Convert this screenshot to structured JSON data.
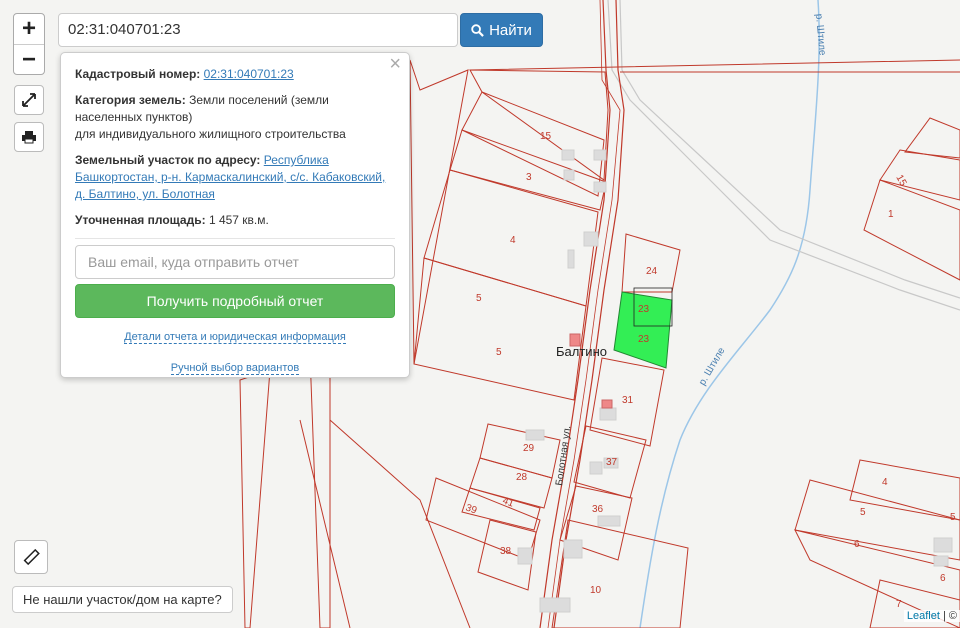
{
  "toolbar": {
    "zoom_in": "+",
    "zoom_out": "−",
    "search_value": "02:31:040701:23",
    "search_button": "Найти"
  },
  "popup": {
    "close": "×",
    "cadastral_label": "Кадастровый номер:",
    "cadastral_value": "02:31:040701:23",
    "category_label": "Категория земель:",
    "category_value": "Земли поселений (земли населенных пунктов)",
    "category_use": "для индивидуального жилищного строительства",
    "address_label": "Земельный участок по адресу:",
    "address_value": "Республика Башкортостан, р-н. Кармаскалинский, с/с. Кабаковский, д. Балтино, ул. Болотная",
    "area_label": "Уточненная площадь:",
    "area_value": "1 457 кв.м.",
    "email_placeholder": "Ваш email, куда отправить отчет",
    "report_button": "Получить подробный отчет",
    "details_link": "Детали отчета и юридическая информация",
    "manual_link": "Ручной выбор вариантов"
  },
  "not_found_button": "Не нашли участок/дом на карте?",
  "attribution": "Leaflet",
  "attribution_rest": "| ©",
  "map": {
    "place_name": "Балтино",
    "street_name": "Болотная ул.",
    "river_name": "р. Штиле",
    "plot_labels": [
      "15",
      "3",
      "4",
      "5",
      "5",
      "24",
      "23",
      "23",
      "31",
      "29",
      "28",
      "41",
      "39",
      "38",
      "37",
      "36",
      "10",
      "15",
      "1",
      "4",
      "5",
      "6",
      "6",
      "7",
      "5"
    ]
  },
  "colors": {
    "boundary": "#c0392b",
    "selected_parcel": "#33ee55",
    "river": "#9cc6e8",
    "search_button": "#337ab7",
    "report_button": "#5cb85c"
  }
}
